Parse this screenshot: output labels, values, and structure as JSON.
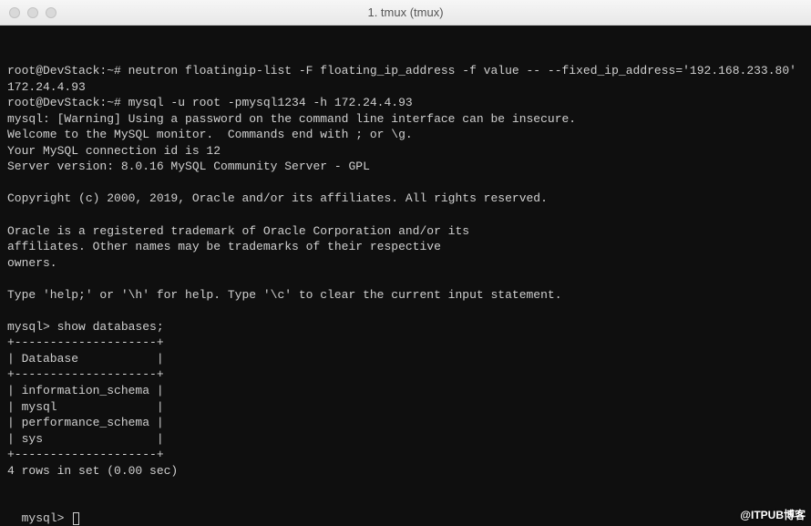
{
  "titlebar": {
    "title": "1. tmux (tmux)"
  },
  "terminal": {
    "lines": [
      "root@DevStack:~# neutron floatingip-list -F floating_ip_address -f value -- --fixed_ip_address='192.168.233.80'",
      "172.24.4.93",
      "root@DevStack:~# mysql -u root -pmysql1234 -h 172.24.4.93",
      "mysql: [Warning] Using a password on the command line interface can be insecure.",
      "Welcome to the MySQL monitor.  Commands end with ; or \\g.",
      "Your MySQL connection id is 12",
      "Server version: 8.0.16 MySQL Community Server - GPL",
      "",
      "Copyright (c) 2000, 2019, Oracle and/or its affiliates. All rights reserved.",
      "",
      "Oracle is a registered trademark of Oracle Corporation and/or its",
      "affiliates. Other names may be trademarks of their respective",
      "owners.",
      "",
      "Type 'help;' or '\\h' for help. Type '\\c' to clear the current input statement.",
      "",
      "mysql> show databases;",
      "+--------------------+",
      "| Database           |",
      "+--------------------+",
      "| information_schema |",
      "| mysql              |",
      "| performance_schema |",
      "| sys                |",
      "+--------------------+",
      "4 rows in set (0.00 sec)",
      ""
    ],
    "prompt": "mysql>"
  },
  "watermark": "@ITPUB博客"
}
